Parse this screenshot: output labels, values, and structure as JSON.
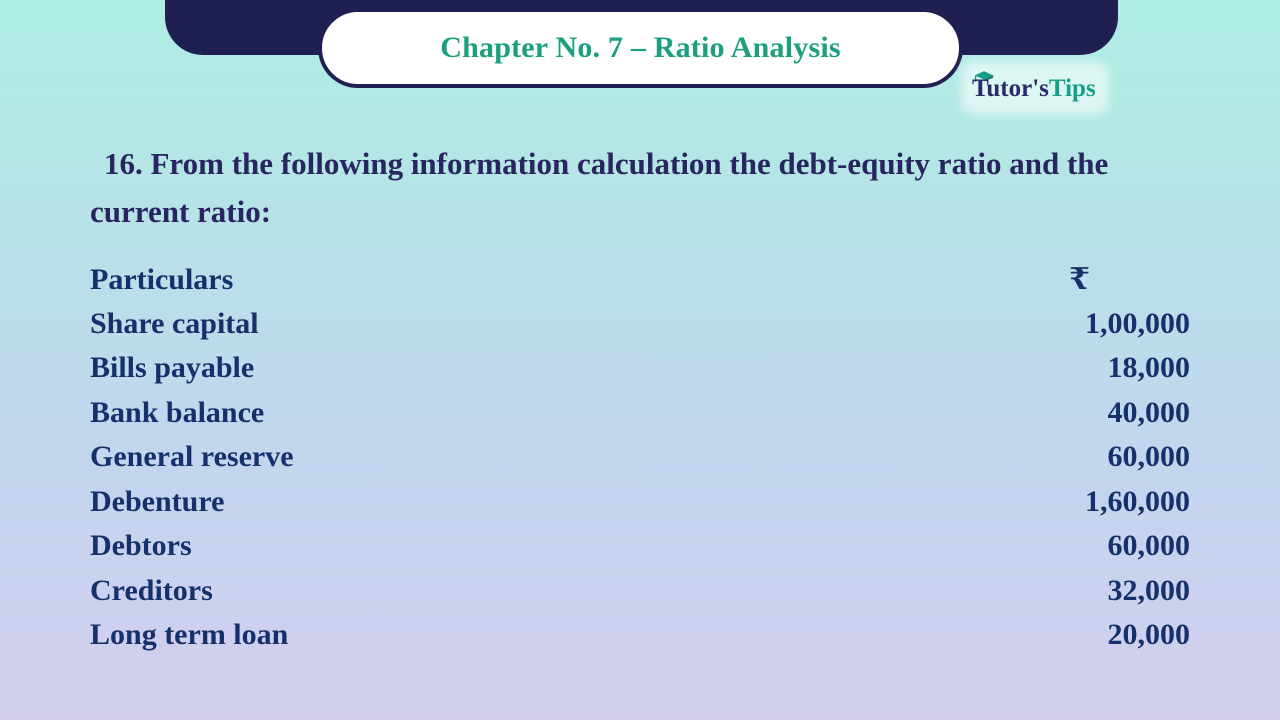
{
  "header": {
    "chapter_title": "Chapter No. 7 – Ratio Analysis",
    "banner_color": "#201f52",
    "title_color": "#1ba07f"
  },
  "logo": {
    "brand_part1": "Tutor's",
    "brand_part2": "Tips",
    "part1_color": "#2a2a6b",
    "part2_color": "#16a085",
    "cap_icon": "graduation-cap-icon"
  },
  "question": {
    "number": "16.",
    "text": "16. From the following information calculation the debt-equity ratio and the current ratio:",
    "color": "#282560"
  },
  "table": {
    "text_color": "#16306b",
    "header": {
      "label": "Particulars",
      "value": "₹"
    },
    "rows": [
      {
        "label": "Share capital",
        "value": "1,00,000"
      },
      {
        "label": "Bills payable",
        "value": "18,000"
      },
      {
        "label": "Bank balance",
        "value": "40,000"
      },
      {
        "label": "General reserve",
        "value": "60,000"
      },
      {
        "label": "Debenture",
        "value": "1,60,000"
      },
      {
        "label": "Debtors",
        "value": "60,000"
      },
      {
        "label": "Creditors",
        "value": "32,000"
      },
      {
        "label": "Long term loan",
        "value": "20,000"
      }
    ]
  },
  "background": {
    "top_color": "#aeeee3",
    "bottom_color": "#d2cfee"
  }
}
